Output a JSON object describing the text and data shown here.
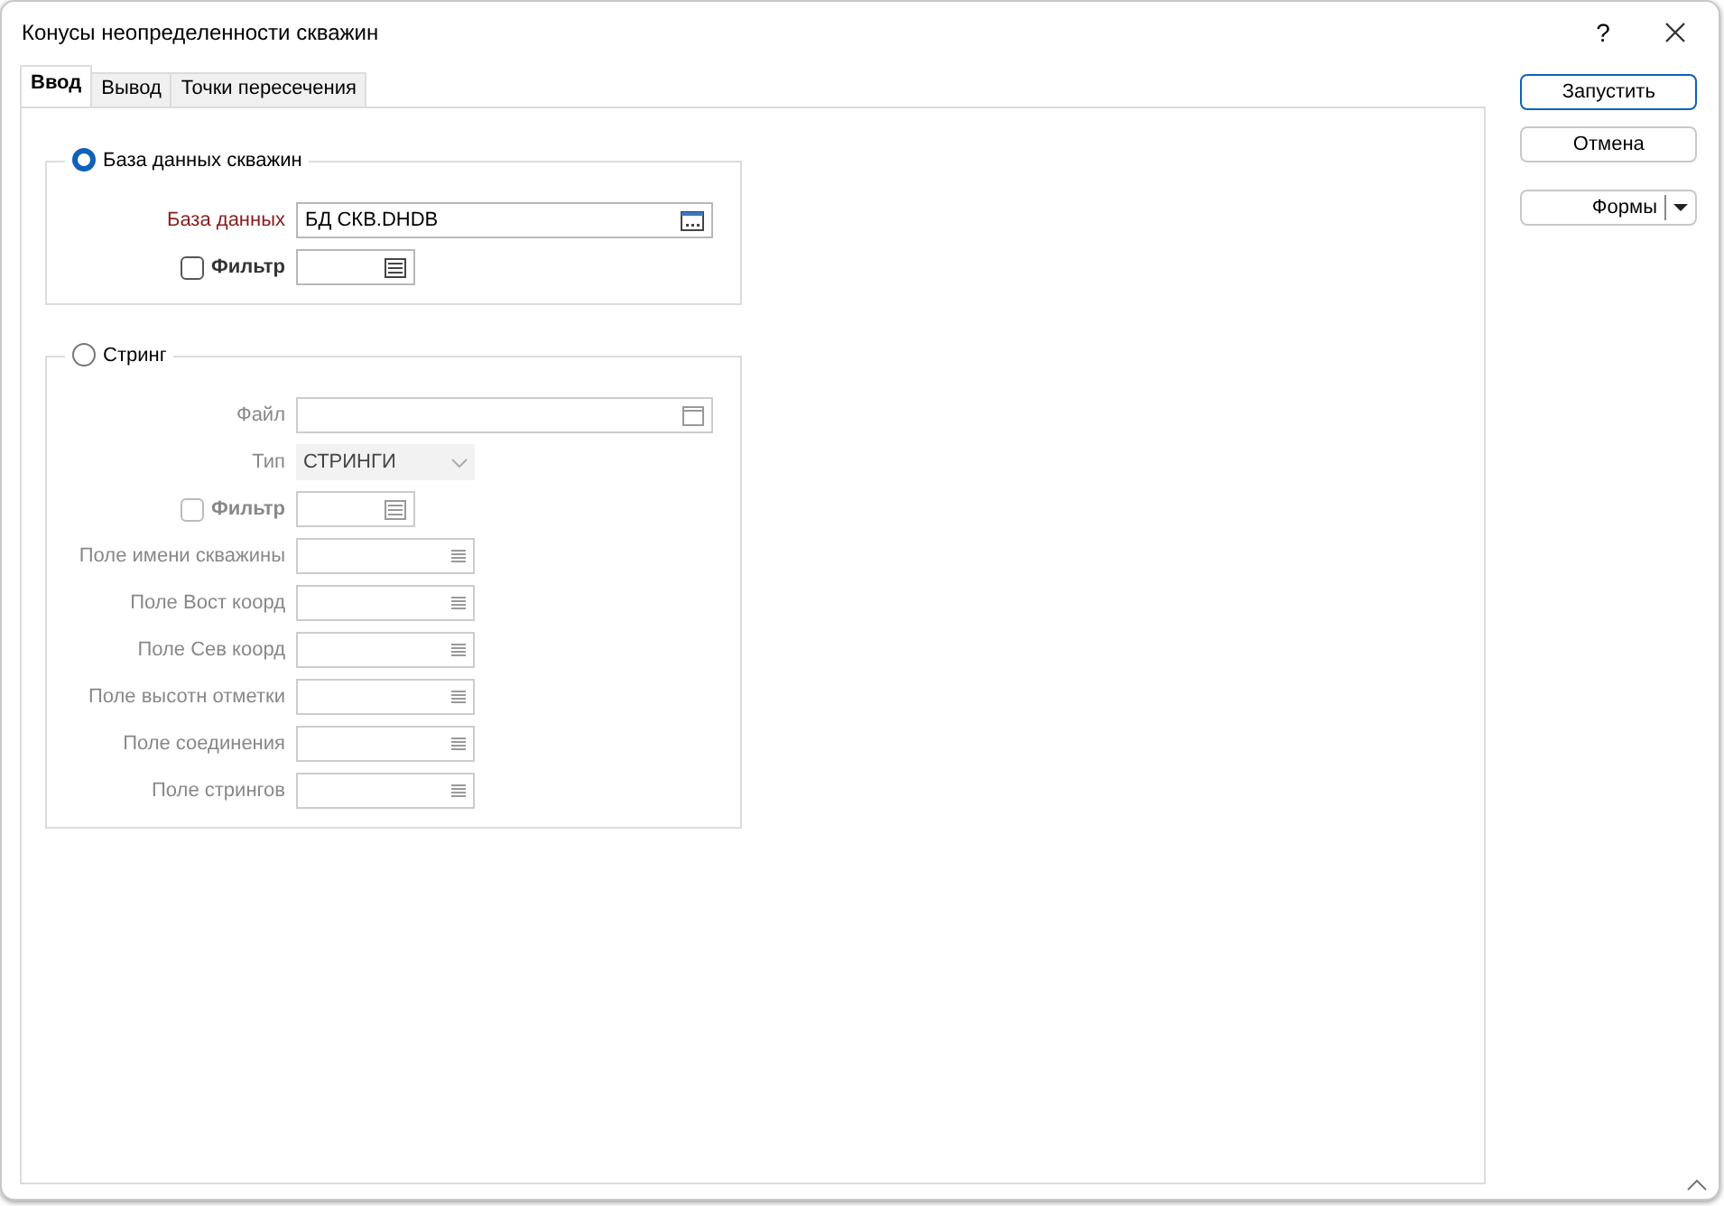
{
  "window": {
    "title": "Конусы неопределенности скважин",
    "help": "?"
  },
  "tabs": [
    {
      "label": "Ввод",
      "selected": true
    },
    {
      "label": "Вывод",
      "selected": false
    },
    {
      "label": "Точки пересечения",
      "selected": false
    }
  ],
  "groups": [
    {
      "title": "База данных скважин",
      "selected": true,
      "rows": [
        {
          "kind": "file",
          "label": "База данных",
          "value": "БД СКВ.DHDB",
          "required": true,
          "disabled": false
        },
        {
          "kind": "filter",
          "label": "Фильтр",
          "checked": false,
          "disabled": false
        }
      ]
    },
    {
      "title": "Стринг",
      "selected": false,
      "rows": [
        {
          "kind": "window",
          "label": "Файл",
          "disabled": true
        },
        {
          "kind": "combo",
          "label": "Тип",
          "value": "СТРИНГИ",
          "disabled": true
        },
        {
          "kind": "filter",
          "label": "Фильтр",
          "checked": false,
          "disabled": true
        },
        {
          "kind": "list",
          "label": "Поле имени скважины",
          "disabled": true
        },
        {
          "kind": "list",
          "label": "Поле Вост коорд",
          "disabled": true
        },
        {
          "kind": "list",
          "label": "Поле Сев коорд",
          "disabled": true
        },
        {
          "kind": "list",
          "label": "Поле высотн отметки",
          "disabled": true
        },
        {
          "kind": "list",
          "label": "Поле соединения",
          "disabled": true
        },
        {
          "kind": "list",
          "label": "Поле стрингов",
          "disabled": true
        }
      ]
    }
  ],
  "buttons": [
    {
      "label": "Запустить",
      "kind": "primary"
    },
    {
      "label": "Отмена",
      "kind": "normal"
    },
    {
      "label": "Формы",
      "kind": "split"
    }
  ]
}
